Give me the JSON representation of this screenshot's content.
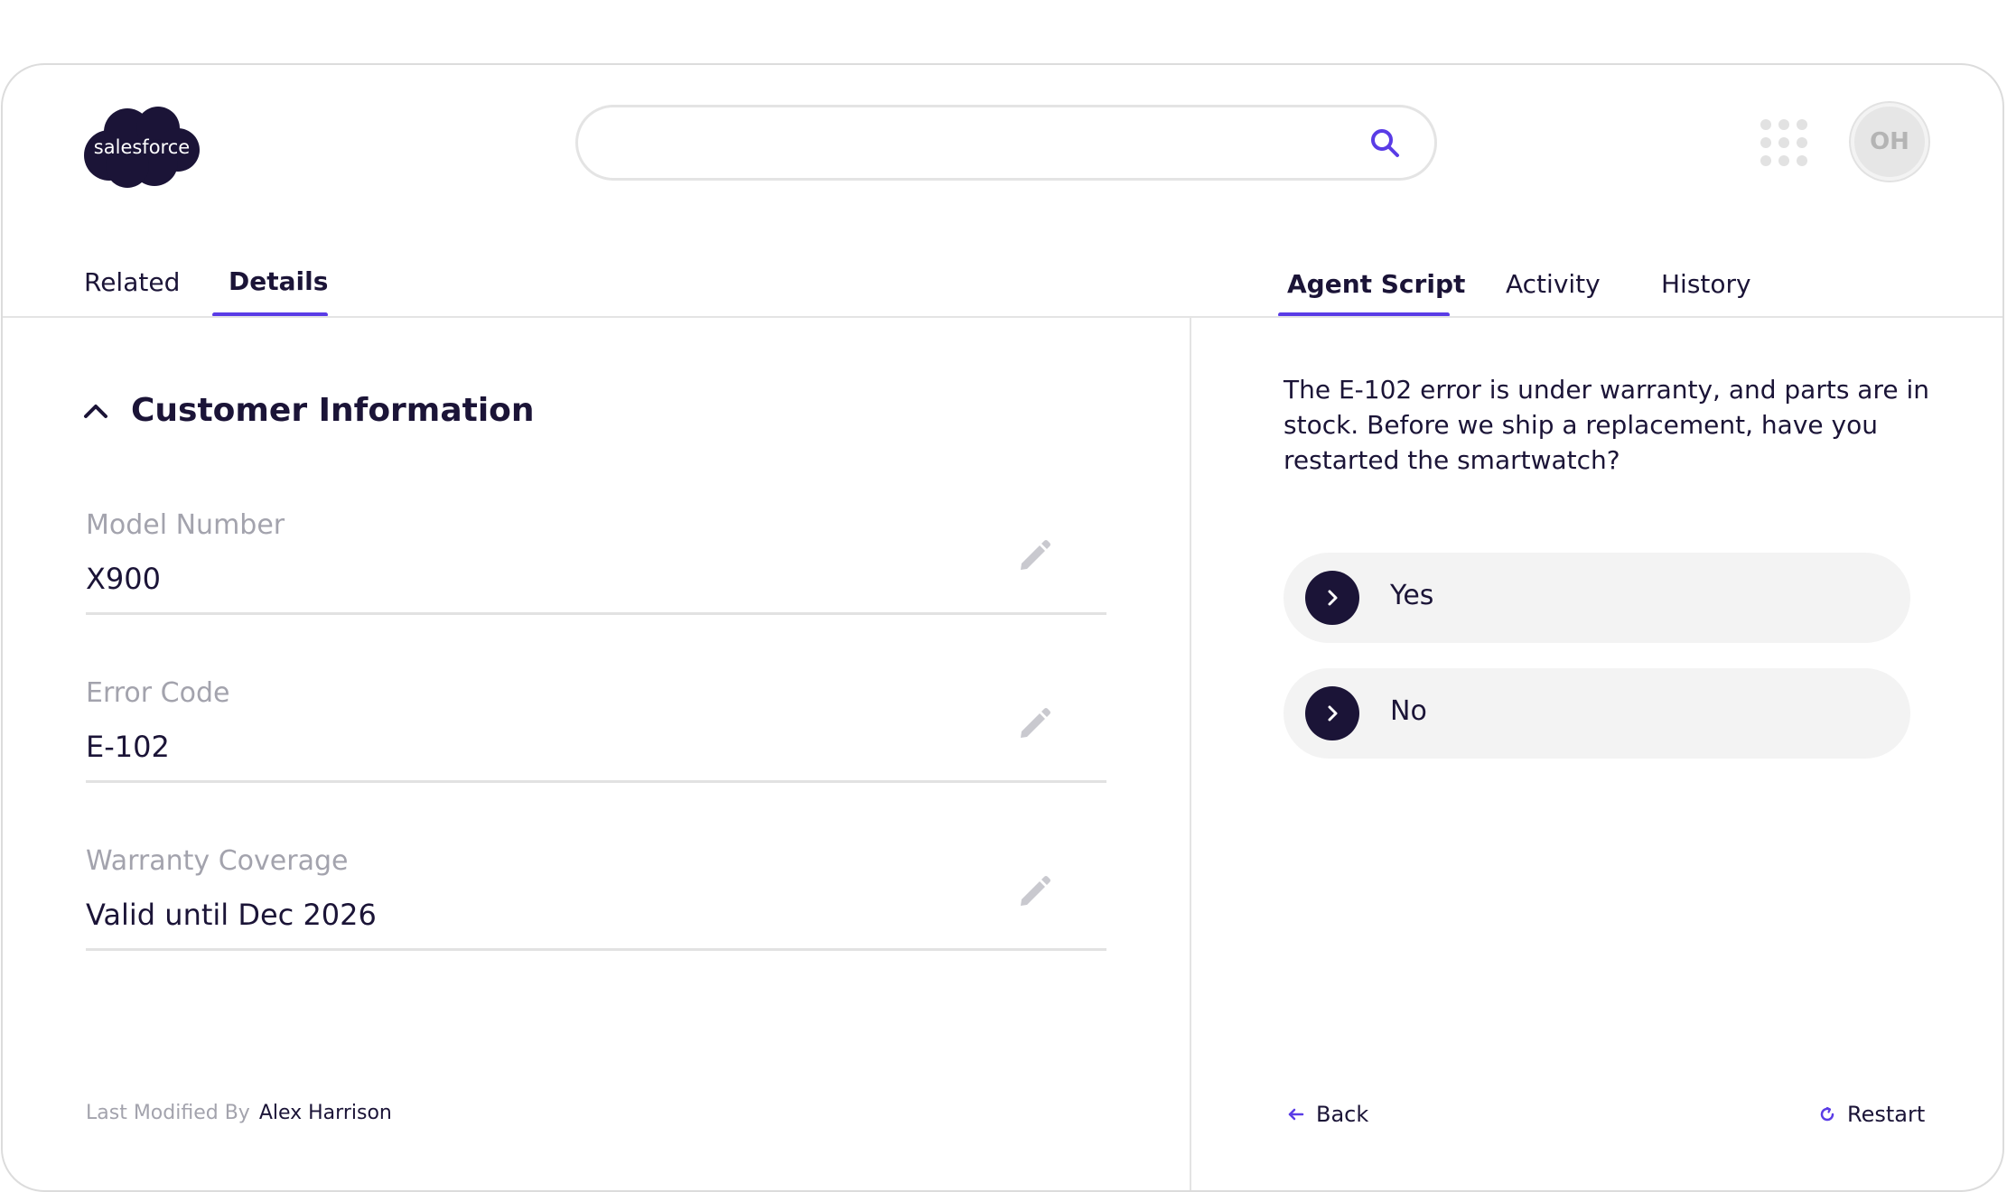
{
  "header": {
    "logo_text": "salesforce",
    "search": {
      "value": "",
      "placeholder": ""
    },
    "avatar_initials": "OH"
  },
  "left_tabs": [
    {
      "label": "Related",
      "active": false
    },
    {
      "label": "Details",
      "active": true
    }
  ],
  "right_tabs": [
    {
      "label": "Agent Script",
      "active": true
    },
    {
      "label": "Activity",
      "active": false
    },
    {
      "label": "History",
      "active": false
    }
  ],
  "customer_info": {
    "title": "Customer Information",
    "fields": [
      {
        "label": "Model Number",
        "value": "X900"
      },
      {
        "label": "Error Code",
        "value": "E-102"
      },
      {
        "label": "Warranty Coverage",
        "value": "Valid until Dec 2026"
      }
    ],
    "last_modified": {
      "label": "Last Modified By",
      "value": "Alex Harrison"
    }
  },
  "agent_script": {
    "text": "The E-102 error is under warranty, and parts are in stock. Before we ship a replacement, have you restarted the smartwatch?",
    "options": [
      {
        "label": "Yes"
      },
      {
        "label": "No"
      }
    ],
    "back_label": "Back",
    "restart_label": "Restart"
  },
  "colors": {
    "accent": "#5a3ce6",
    "dark": "#1b1437",
    "muted_text": "#a3a3ad",
    "option_bg": "#f3f3f3",
    "border": "#e4e4e4"
  },
  "icons": {
    "search": "search-icon",
    "apps": "apps-grid-icon",
    "collapse": "chevron-up-icon",
    "edit": "pencil-icon",
    "option": "chevron-right-icon",
    "back": "arrow-left-icon",
    "restart": "refresh-icon"
  }
}
